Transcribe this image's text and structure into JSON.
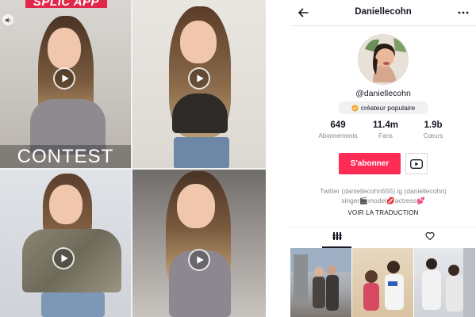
{
  "feed": {
    "promo_banner": "SPLIC APP",
    "contest_label": "CONTEST",
    "tiles": [
      {
        "name": "video-tile-1"
      },
      {
        "name": "video-tile-2"
      },
      {
        "name": "video-tile-3"
      },
      {
        "name": "video-tile-4"
      }
    ]
  },
  "profile": {
    "title": "Daniellecohn",
    "handle": "@daniellecohn",
    "badge": "créateur populaire",
    "stats": [
      {
        "value": "649",
        "label": "Abonnements"
      },
      {
        "value": "11.4m",
        "label": "Fans"
      },
      {
        "value": "1.9b",
        "label": "Cœurs"
      }
    ],
    "follow_label": "S'abonner",
    "bio_line1": "Twitter (daniellecohn555) ig (daniellecohn)",
    "bio_line2": "singer🎬model💋actress💕",
    "translate_label": "VOIR LA TRADUCTION"
  },
  "icons": {
    "back": "arrow-left-icon",
    "more": "more-dots-icon",
    "badge": "verified-badge-icon",
    "youtube": "youtube-icon",
    "grid_tab": "grid-icon",
    "liked_tab": "heart-outline-icon",
    "play": "play-icon",
    "sound": "speaker-icon"
  },
  "colors": {
    "accent": "#fe2c55",
    "badge": "#f5a623",
    "promo": "#e2284a"
  }
}
